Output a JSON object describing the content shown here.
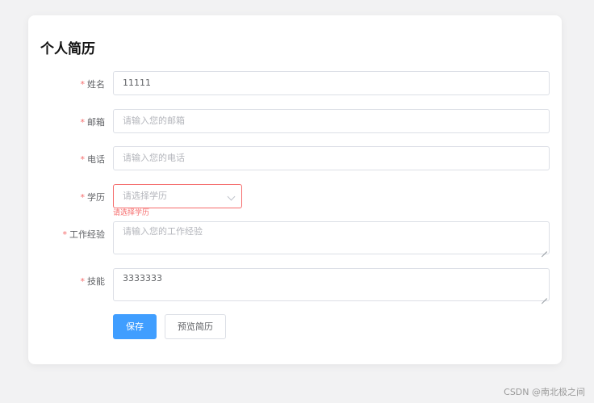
{
  "form": {
    "title": "个人简历",
    "required_mark": "*",
    "fields": [
      {
        "label": "姓名",
        "value": "11111",
        "placeholder": ""
      },
      {
        "label": "邮箱",
        "value": "",
        "placeholder": "请输入您的邮箱"
      },
      {
        "label": "电话",
        "value": "",
        "placeholder": "请输入您的电话"
      },
      {
        "label": "学历",
        "value": "",
        "placeholder": "请选择学历",
        "error": "请选择学历"
      },
      {
        "label": "工作经验",
        "value": "",
        "placeholder": "请输入您的工作经验"
      },
      {
        "label": "技能",
        "value": "3333333",
        "placeholder": ""
      }
    ],
    "buttons": {
      "save": "保存",
      "preview": "预览简历"
    }
  },
  "watermark": "CSDN @南北极之间",
  "colors": {
    "primary": "#409eff",
    "error": "#f56c6c",
    "border": "#dcdfe6",
    "placeholder": "#b4b6bc"
  }
}
